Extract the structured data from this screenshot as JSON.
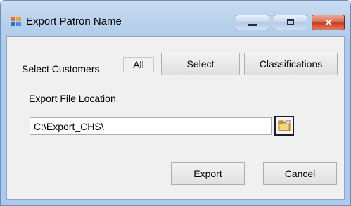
{
  "window": {
    "title": "Export Patron Name",
    "minimize_icon": "minimize-icon",
    "maximize_icon": "maximize-icon",
    "close_icon": "close-icon",
    "close_glyph": "✕",
    "app_icon": "app-icon"
  },
  "customers": {
    "label": "Select Customers",
    "selection_value": "All",
    "select_button": "Select",
    "classifications_button": "Classifications"
  },
  "export_location": {
    "label": "Export File Location",
    "path_value": "C:\\Export_CHS\\",
    "browse_icon": "folder-browse-icon"
  },
  "actions": {
    "export_button": "Export",
    "cancel_button": "Cancel"
  },
  "colors": {
    "close_button": "#c83c1f",
    "title_bar": "#b9d1ec",
    "client_area": "#f0f0f0"
  }
}
